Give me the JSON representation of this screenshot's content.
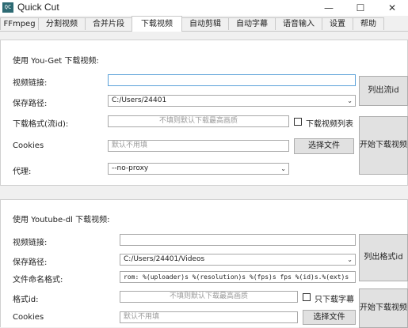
{
  "window": {
    "app_icon_text": "QC",
    "title": "Quick Cut",
    "minimize": "—",
    "maximize": "☐",
    "close": "✕"
  },
  "tabs": [
    "FFmpeg",
    "分割视频",
    "合并片段",
    "下载视频",
    "自动剪辑",
    "自动字幕",
    "语音输入",
    "设置",
    "帮助"
  ],
  "active_tab": "下载视频",
  "youget": {
    "section_title": "使用 You-Get 下载视频:",
    "url_label": "视频链接:",
    "url_value": "",
    "save_label": "保存路径:",
    "save_value": "C:/Users/24401",
    "format_label": "下载格式(流id):",
    "format_placeholder": "不填则默认下载最高画质",
    "list_label": "下载视频列表",
    "cookies_label": "Cookies",
    "cookies_placeholder": "默认不用填",
    "choose_file": "选择文件",
    "proxy_label": "代理:",
    "proxy_value": "--no-proxy",
    "list_streams_btn": "列出流id",
    "download_btn": "开始下载视频"
  },
  "ytdl": {
    "section_title": "使用 Youtube-dl 下载视频:",
    "url_label": "视频链接:",
    "url_value": "",
    "save_label": "保存路径:",
    "save_value": "C:/Users/24401/Videos",
    "name_label": "文件命名格式:",
    "name_value": "rom: %(uploader)s %(resolution)s %(fps)s fps %(id)s.%(ext)s",
    "format_label": "格式id:",
    "format_placeholder": "不填则默认下载最高画质",
    "subs_only_label": "只下载字幕",
    "cookies_label": "Cookies",
    "cookies_placeholder": "默认不用填",
    "choose_file": "选择文件",
    "list_formats_btn": "列出格式id",
    "download_btn": "开始下载视频"
  }
}
